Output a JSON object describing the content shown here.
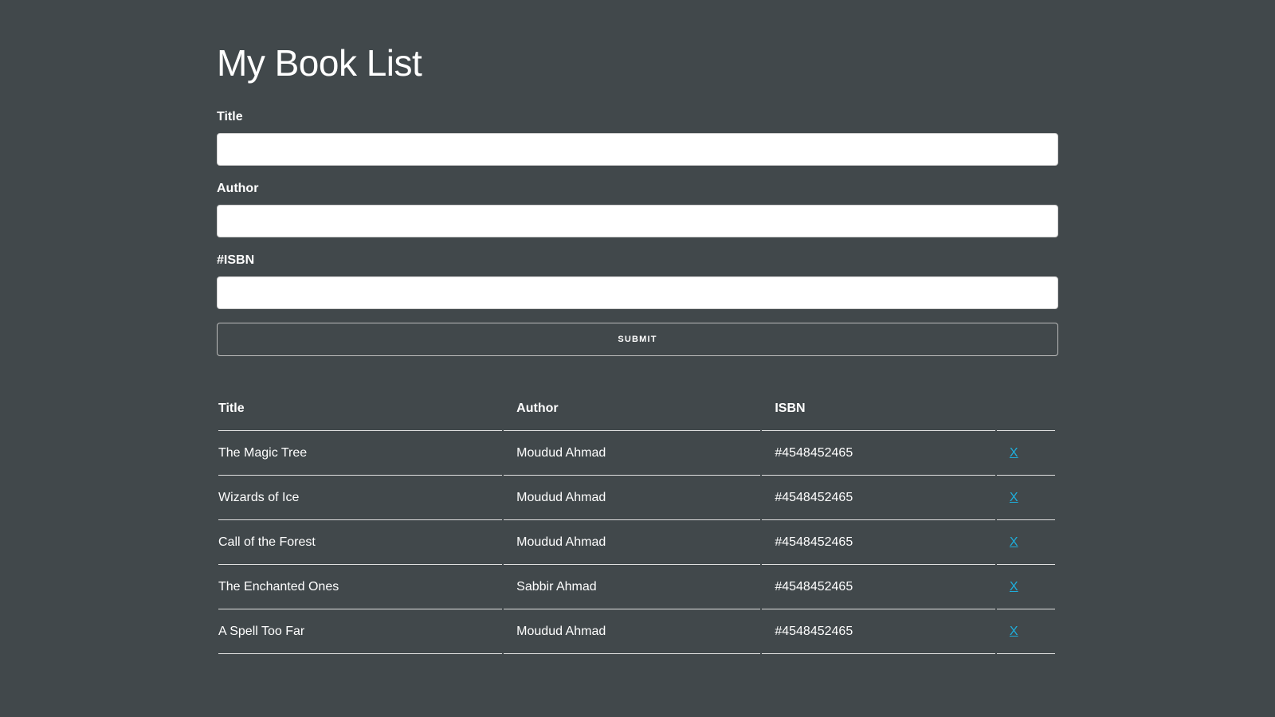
{
  "page": {
    "heading": "My Book List"
  },
  "form": {
    "title_label": "Title",
    "title_value": "",
    "author_label": "Author",
    "author_value": "",
    "isbn_label": "#ISBN",
    "isbn_value": "",
    "submit_label": "SUBMIT"
  },
  "table": {
    "headers": {
      "title": "Title",
      "author": "Author",
      "isbn": "ISBN"
    },
    "rows": [
      {
        "title": "The Magic Tree",
        "author": "Moudud Ahmad",
        "isbn": "#4548452465",
        "delete": "X"
      },
      {
        "title": "Wizards of Ice",
        "author": "Moudud Ahmad",
        "isbn": "#4548452465",
        "delete": "X"
      },
      {
        "title": "Call of the Forest",
        "author": "Moudud Ahmad",
        "isbn": "#4548452465",
        "delete": "X"
      },
      {
        "title": "The Enchanted Ones",
        "author": "Sabbir Ahmad",
        "isbn": "#4548452465",
        "delete": "X"
      },
      {
        "title": "A Spell Too Far",
        "author": "Moudud Ahmad",
        "isbn": "#4548452465",
        "delete": "X"
      }
    ]
  },
  "colors": {
    "background": "#41484b",
    "text": "#ffffff",
    "link": "#1eaedb"
  }
}
